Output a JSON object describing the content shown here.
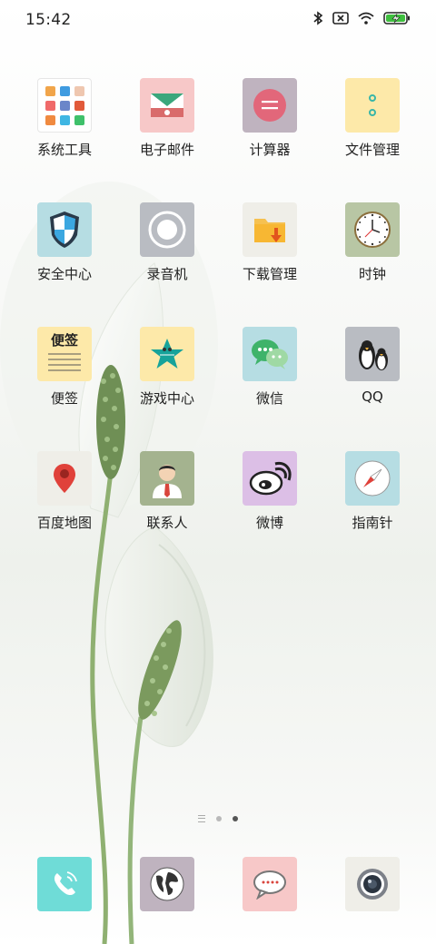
{
  "status_bar": {
    "time": "15:42",
    "icons": [
      "bluetooth-icon",
      "sim-disabled-icon",
      "wifi-icon",
      "battery-charging-icon"
    ]
  },
  "apps": [
    {
      "label": "系统工具",
      "icon": "tools-folder-icon"
    },
    {
      "label": "电子邮件",
      "icon": "email-icon",
      "color": "#f7c8c8"
    },
    {
      "label": "计算器",
      "icon": "calculator-icon",
      "color": "#bfb3bf"
    },
    {
      "label": "文件管理",
      "icon": "file-manager-icon",
      "color": "#fde9a9"
    },
    {
      "label": "安全中心",
      "icon": "shield-icon",
      "color": "#b6dde3"
    },
    {
      "label": "录音机",
      "icon": "recorder-icon",
      "color": "#b9bcc2"
    },
    {
      "label": "下载管理",
      "icon": "download-folder-icon",
      "color": "#efeee8"
    },
    {
      "label": "时钟",
      "icon": "clock-icon",
      "color": "#b8c6a4"
    },
    {
      "label": "便签",
      "icon": "notes-icon",
      "color": "#fde9a9",
      "icon_text": "便签"
    },
    {
      "label": "游戏中心",
      "icon": "star-icon",
      "color": "#fde9a9"
    },
    {
      "label": "微信",
      "icon": "wechat-icon",
      "color": "#b6dde3"
    },
    {
      "label": "QQ",
      "icon": "penguin-icon",
      "color": "#b9bcc2"
    },
    {
      "label": "百度地图",
      "icon": "map-pin-icon",
      "color": "#efeee8"
    },
    {
      "label": "联系人",
      "icon": "contact-person-icon",
      "color": "#a4b38f"
    },
    {
      "label": "微博",
      "icon": "weibo-icon",
      "color": "#dcbfe6"
    },
    {
      "label": "指南针",
      "icon": "compass-icon",
      "color": "#b6dde3"
    }
  ],
  "pager": {
    "pages": 2,
    "active": 2
  },
  "dock": [
    {
      "icon": "phone-icon",
      "color": "#6fdcd7"
    },
    {
      "icon": "globe-icon",
      "color": "#bfb3bf"
    },
    {
      "icon": "message-icon",
      "color": "#f7c8c8"
    },
    {
      "icon": "camera-icon",
      "color": "#efeee8"
    }
  ]
}
